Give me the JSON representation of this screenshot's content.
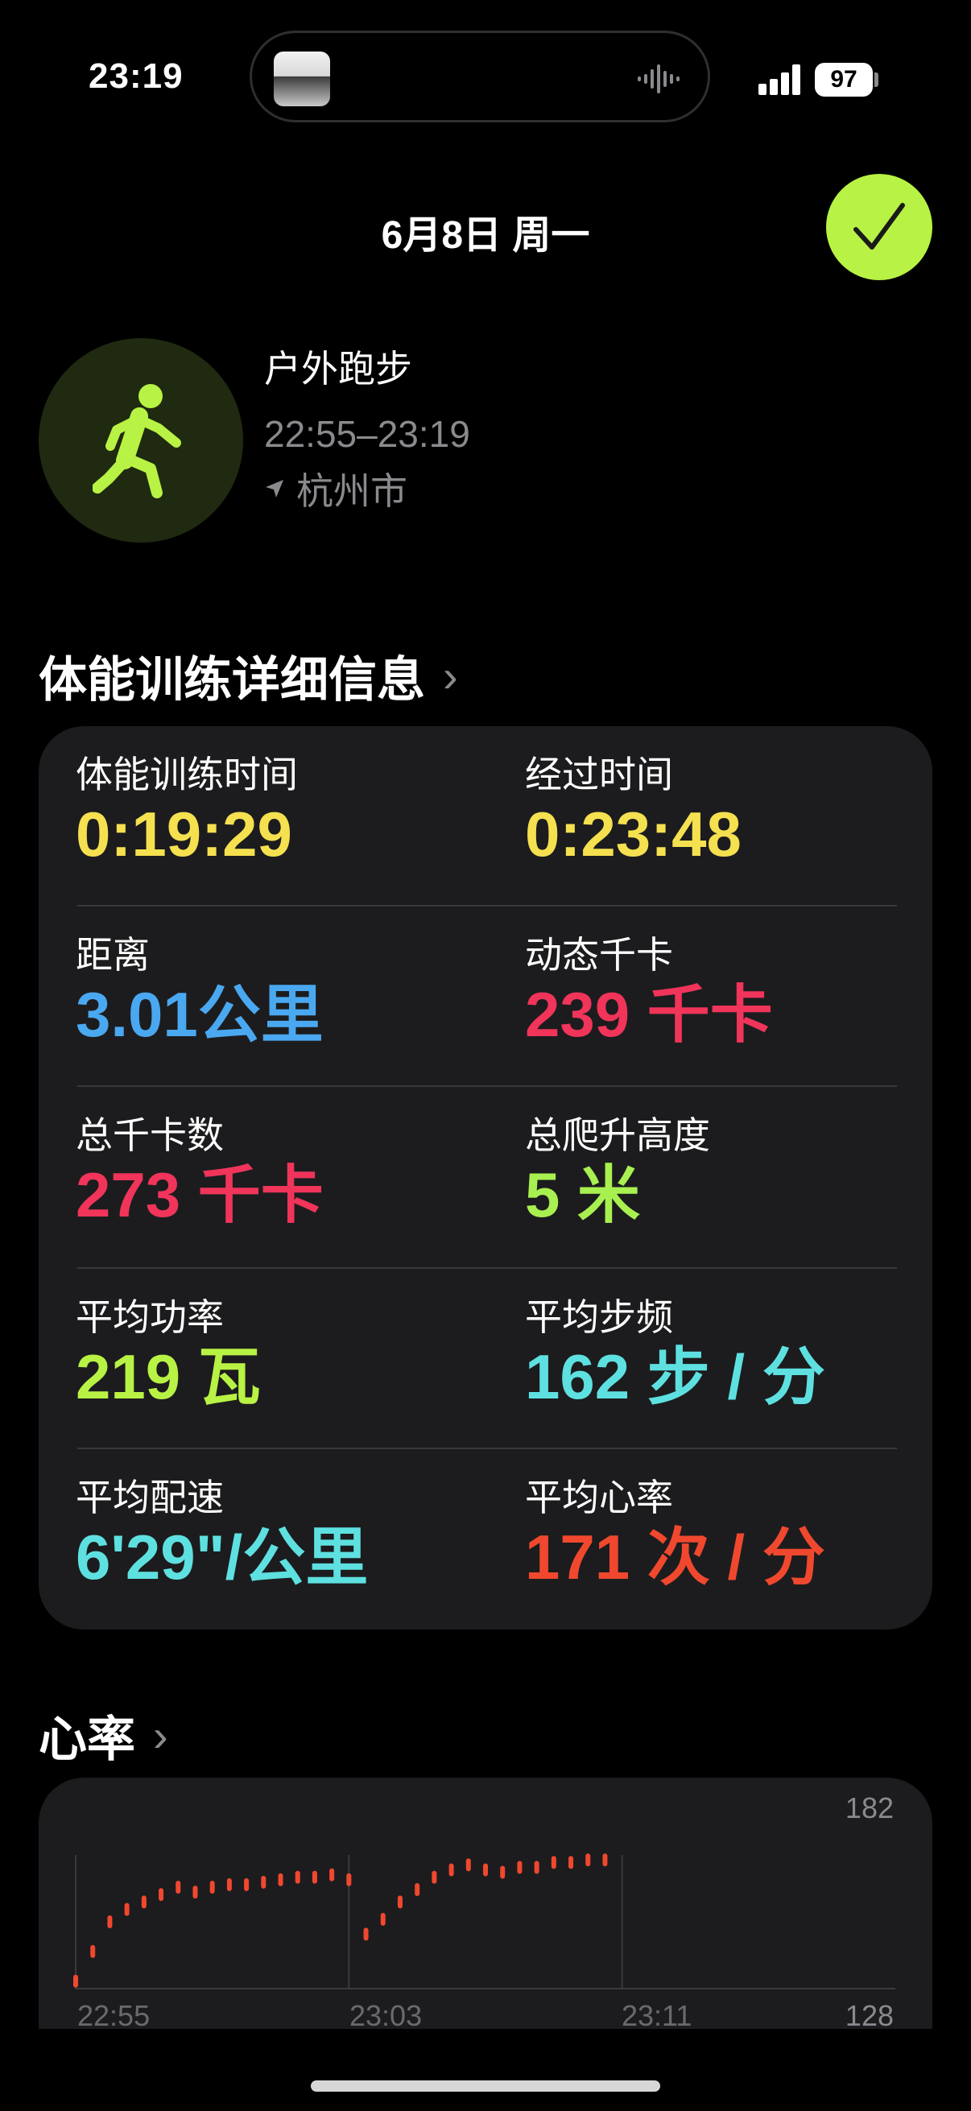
{
  "status": {
    "time": "23:19",
    "battery": "97"
  },
  "header": {
    "date": "6月8日 周一"
  },
  "workout": {
    "name": "户外跑步",
    "time_range": "22:55–23:19",
    "location": "杭州市"
  },
  "details": {
    "title": "体能训练详细信息",
    "metrics": [
      {
        "label": "体能训练时间",
        "value": "0:19:29",
        "color": "#f5e050"
      },
      {
        "label": "经过时间",
        "value": "0:23:48",
        "color": "#f5e050"
      },
      {
        "label": "距离",
        "value": "3.01公里",
        "color": "#4aa8f0"
      },
      {
        "label": "动态千卡",
        "value": "239 千卡",
        "color": "#f0345a"
      },
      {
        "label": "总千卡数",
        "value": "273 千卡",
        "color": "#f0345a"
      },
      {
        "label": "总爬升高度",
        "value": "5 米",
        "color": "#a8f050"
      },
      {
        "label": "平均功率",
        "value": "219 瓦",
        "color": "#b8f244"
      },
      {
        "label": "平均步频",
        "value": "162 步 / 分",
        "color": "#5ee0e0"
      },
      {
        "label": "平均配速",
        "value": "6'29\"/公里",
        "color": "#5ee0e0"
      },
      {
        "label": "平均心率",
        "value": "171 次 / 分",
        "color": "#f0482e"
      }
    ]
  },
  "heart_rate": {
    "title": "心率",
    "y_max_label": "182",
    "y_min_label": "128",
    "x_labels": [
      "22:55",
      "23:03",
      "23:11"
    ]
  },
  "chart_data": {
    "type": "scatter",
    "title": "心率",
    "ylim": [
      128,
      182
    ],
    "x_labels": [
      "22:55",
      "23:03",
      "23:11"
    ],
    "series": [
      {
        "color": "#f0482e",
        "x": [
          "22:55",
          "22:55:30",
          "22:56",
          "22:56:30",
          "22:57",
          "22:57:30",
          "22:58",
          "22:58:30",
          "22:59",
          "22:59:30",
          "23:00",
          "23:00:30",
          "23:01",
          "23:01:30",
          "23:02",
          "23:02:30",
          "23:03",
          "23:03:30",
          "23:04",
          "23:04:30",
          "23:05",
          "23:05:30",
          "23:06",
          "23:06:30",
          "23:07",
          "23:07:30",
          "23:08",
          "23:08:30",
          "23:09",
          "23:09:30",
          "23:10",
          "23:10:30"
        ],
        "y": [
          131,
          143,
          155,
          160,
          163,
          166,
          169,
          167,
          169,
          170,
          170,
          171,
          172,
          173,
          173,
          174,
          172,
          150,
          156,
          163,
          168,
          173,
          176,
          178,
          176,
          175,
          177,
          177,
          179,
          179,
          180,
          180
        ]
      }
    ]
  }
}
